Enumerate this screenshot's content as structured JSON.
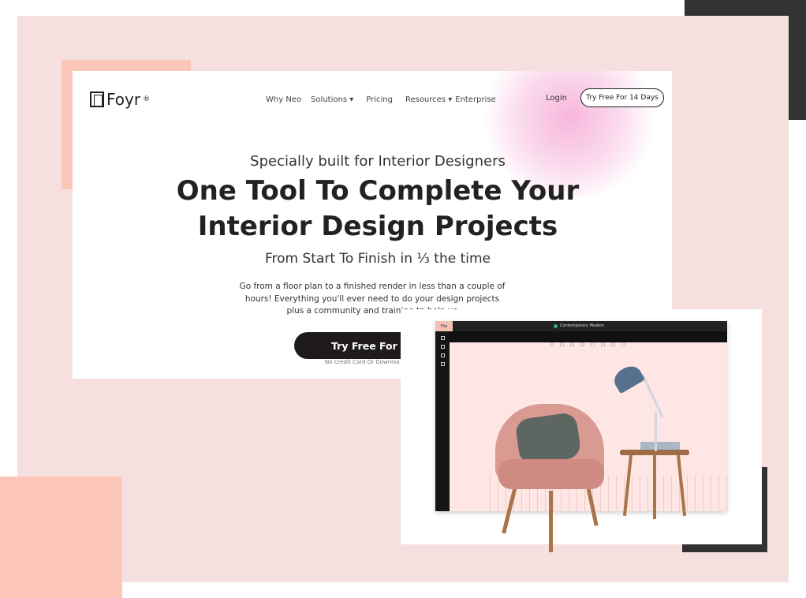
{
  "header": {
    "logo": "Foyr",
    "logo_mark": "®",
    "nav": [
      "Why Neo",
      "Solutions ▾",
      "Pricing",
      "Resources ▾",
      "Enterprise"
    ],
    "login": "Login",
    "try_button": "Try Free For 14 Days"
  },
  "hero": {
    "subtitle": "Specially built for Interior Designers",
    "title_line1": "One Tool To Complete Your",
    "title_line2": "Interior Design Projects",
    "tagline": "From Start To Finish in ⅓ the time",
    "description": "Go from a floor plan to a finished render in less than a couple of hours! Everything you'll ever need to do your design projects plus a community and training to help yo",
    "cta": "Try Free For 14",
    "note": "No Credit Card Or Downloa"
  },
  "app": {
    "file_tab": "File",
    "document": "Contemporary Modern"
  },
  "colors": {
    "panel": "#f5e0df",
    "salmon": "#fcc6b8",
    "dark": "#333333",
    "cta": "#1f1b1c"
  }
}
